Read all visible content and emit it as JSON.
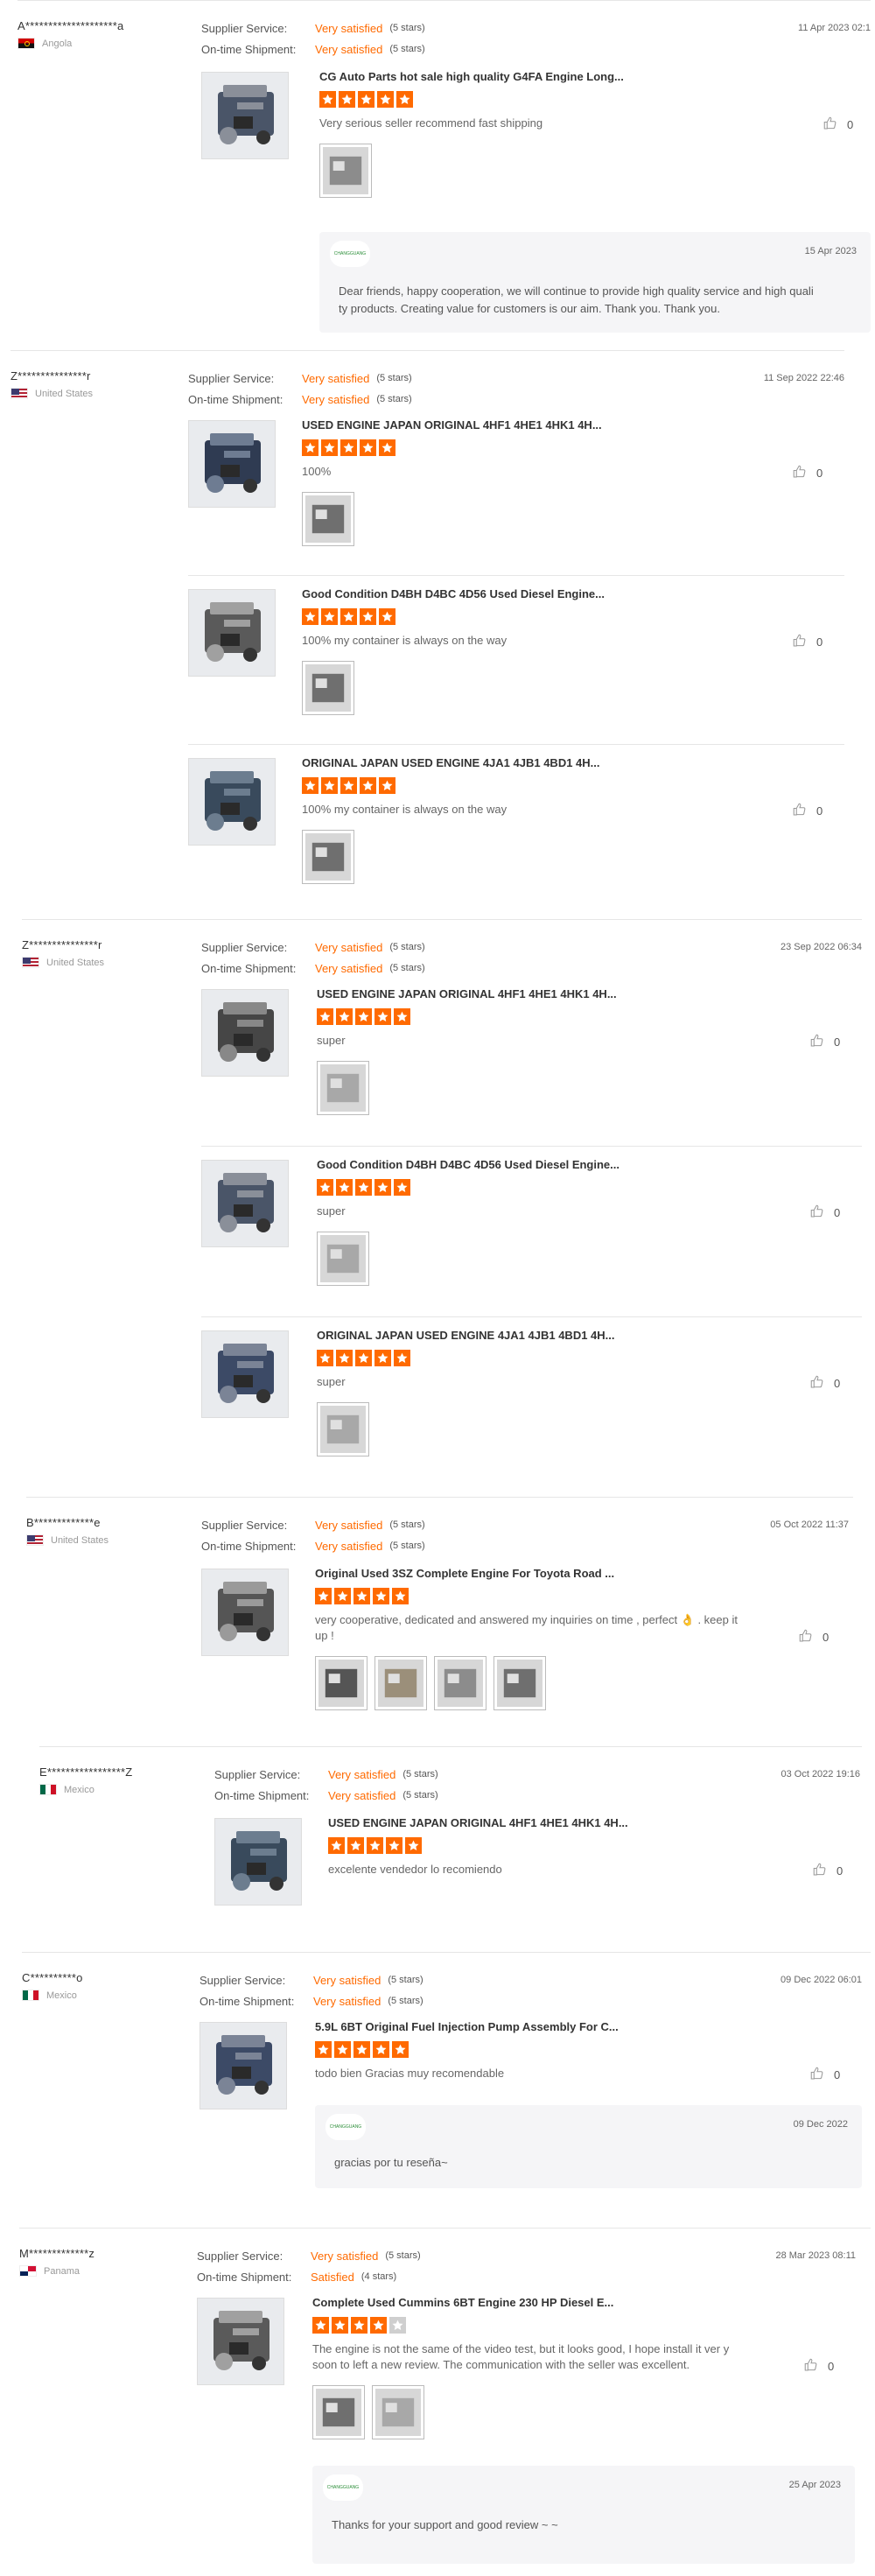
{
  "labels": {
    "supplier_service": "Supplier Service:",
    "ontime_shipment": "On-time Shipment:"
  },
  "colors": {
    "accent": "#ff6a00",
    "star_empty": "#cfcfcf",
    "reply_bg": "#f5f5f7"
  },
  "reviews": [
    {
      "name": "A********************a",
      "country": "Angola",
      "flag": "angola-flag",
      "supplier_service": "Very satisfied",
      "supplier_stars": "(5 stars)",
      "ontime_shipment": "Very satisfied",
      "ontime_stars": "(5 stars)",
      "date": "11 Apr 2023 02:1",
      "products": [
        {
          "title": "CG Auto Parts hot sale high quality G4FA Engine Long...",
          "rating": 5,
          "comment": "Very serious seller recommend fast shipping",
          "likes": "0",
          "images": 1
        }
      ],
      "reply": {
        "logo": "CHANGGUANG",
        "date": "15 Apr 2023",
        "text": [
          "Dear friends, happy cooperation, we will continue to provide high quality service and high quali",
          "ty products. Creating value for customers is our aim. Thank you. Thank you."
        ]
      }
    },
    {
      "name": "Z***************r",
      "country": "United States",
      "flag": "us-flag",
      "supplier_service": "Very satisfied",
      "supplier_stars": "(5 stars)",
      "ontime_shipment": "Very satisfied",
      "ontime_stars": "(5 stars)",
      "date": "11 Sep 2022 22:46",
      "products": [
        {
          "title": "USED ENGINE JAPAN ORIGINAL 4HF1 4HE1 4HK1 4H...",
          "rating": 5,
          "comment": "100%",
          "likes": "0",
          "images": 1
        },
        {
          "title": "Good Condition D4BH D4BC 4D56 Used Diesel Engine...",
          "rating": 5,
          "comment": "100% my container is always on the way",
          "likes": "0",
          "images": 1
        },
        {
          "title": "ORIGINAL JAPAN USED ENGINE 4JA1 4JB1 4BD1 4H...",
          "rating": 5,
          "comment": "100% my container is always on the way",
          "likes": "0",
          "images": 1
        }
      ]
    },
    {
      "name": "Z***************r",
      "country": "United States",
      "flag": "us-flag",
      "supplier_service": "Very satisfied",
      "supplier_stars": "(5 stars)",
      "ontime_shipment": "Very satisfied",
      "ontime_stars": "(5 stars)",
      "date": "23 Sep 2022 06:34",
      "products": [
        {
          "title": "USED ENGINE JAPAN ORIGINAL 4HF1 4HE1 4HK1 4H...",
          "rating": 5,
          "comment": "super",
          "likes": "0",
          "images": 1
        },
        {
          "title": "Good Condition D4BH D4BC 4D56 Used Diesel Engine...",
          "rating": 5,
          "comment": "super",
          "likes": "0",
          "images": 1
        },
        {
          "title": "ORIGINAL JAPAN USED ENGINE 4JA1 4JB1 4BD1 4H...",
          "rating": 5,
          "comment": "super",
          "likes": "0",
          "images": 1
        }
      ]
    },
    {
      "name": "B*************e",
      "country": "United States",
      "flag": "us-flag",
      "supplier_service": "Very satisfied",
      "supplier_stars": "(5 stars)",
      "ontime_shipment": "Very satisfied",
      "ontime_stars": "(5 stars)",
      "date": "05 Oct 2022 11:37",
      "products": [
        {
          "title": "Original Used 3SZ Complete Engine For Toyota Road ...",
          "rating": 5,
          "comment": "very cooperative,  dedicated and answered my inquiries on time , perfect 👌 . keep it up !",
          "likes": "0",
          "images": 4
        }
      ]
    },
    {
      "name": "E*****************Z",
      "country": "Mexico",
      "flag": "mexico-flag",
      "supplier_service": "Very satisfied",
      "supplier_stars": "(5 stars)",
      "ontime_shipment": "Very satisfied",
      "ontime_stars": "(5 stars)",
      "date": "03 Oct 2022 19:16",
      "products": [
        {
          "title": "USED ENGINE JAPAN ORIGINAL 4HF1 4HE1 4HK1 4H...",
          "rating": 5,
          "comment": "excelente vendedor lo recomiendo",
          "likes": "0",
          "images": 0
        }
      ]
    },
    {
      "name": "C**********o",
      "country": "Mexico",
      "flag": "mexico-flag",
      "supplier_service": "Very satisfied",
      "supplier_stars": "(5 stars)",
      "ontime_shipment": "Very satisfied",
      "ontime_stars": "(5 stars)",
      "date": "09 Dec 2022 06:01",
      "products": [
        {
          "title": "5.9L 6BT Original Fuel Injection Pump Assembly For C...",
          "rating": 5,
          "comment": "todo bien Gracias muy recomendable",
          "likes": "0",
          "images": 0
        }
      ],
      "reply": {
        "logo": "CHANGGUANG",
        "date": "09 Dec 2022",
        "text": [
          "gracias por tu reseña~"
        ]
      }
    },
    {
      "name": "M*************z",
      "country": "Panama",
      "flag": "panama-flag",
      "supplier_service": "Very satisfied",
      "supplier_stars": "(5 stars)",
      "ontime_shipment": "Satisfied",
      "ontime_stars": "(4 stars)",
      "date": "28 Mar 2023 08:11",
      "products": [
        {
          "title": "Complete Used Cummins 6BT Engine 230 HP Diesel E...",
          "rating": 4,
          "comment": "The engine is not the same of the video test, but it looks good, I hope install it ver y soon to left a new review. The communication with the seller was excellent.",
          "likes": "0",
          "images": 2
        }
      ],
      "reply": {
        "logo": "CHANGGUANG",
        "date": "25 Apr 2023",
        "text": [
          "Thanks for your support and good review ~ ~"
        ]
      }
    }
  ]
}
